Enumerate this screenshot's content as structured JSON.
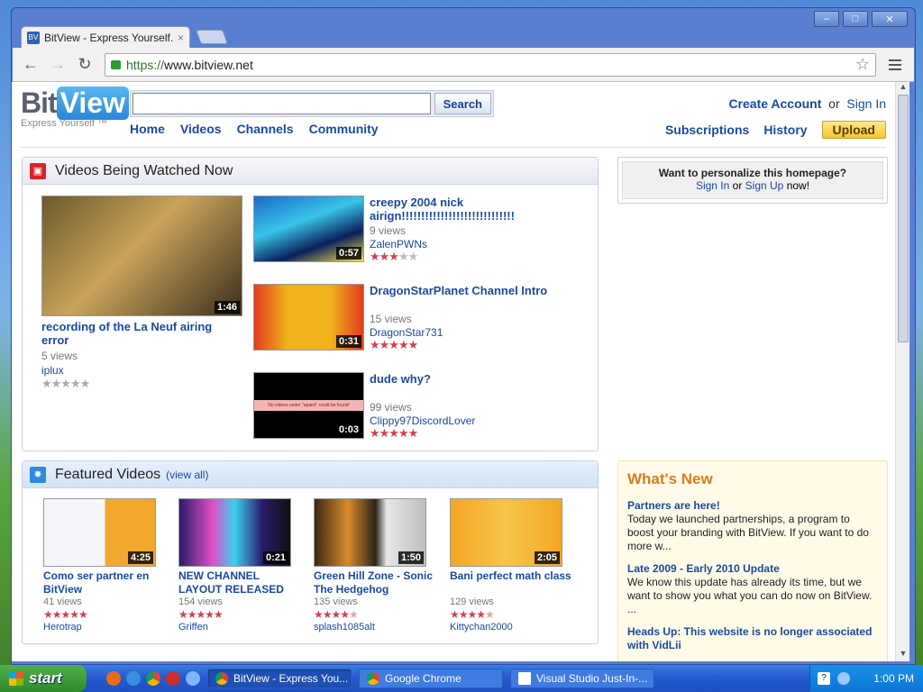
{
  "browser": {
    "tab_title": "BitView - Express Yourself.",
    "tab_close": "×",
    "url_scheme": "https://",
    "url_host": "www.bitview.net",
    "window_buttons": [
      "–",
      "□",
      "✕"
    ]
  },
  "header": {
    "logo_bit": "Bit",
    "logo_view": "View",
    "logo_tagline": "Express Yourself ™",
    "search_button": "Search",
    "nav": [
      "Home",
      "Videos",
      "Channels",
      "Community"
    ],
    "create_account": "Create Account",
    "or": "or",
    "sign_in": "Sign In",
    "subscriptions": "Subscriptions",
    "history": "History",
    "upload": "Upload"
  },
  "watched": {
    "heading": "Videos Being Watched Now",
    "main": {
      "title": "recording of the La Neuf airing error",
      "duration": "1:46",
      "views": "5 views",
      "user": "iplux",
      "rating": 0
    },
    "items": [
      {
        "title": "creepy 2004 nick airign!!!!!!!!!!!!!!!!!!!!!!!!!!!!!",
        "duration": "0:57",
        "views": "9 views",
        "user": "ZalenPWNs",
        "rating": 3
      },
      {
        "title": "DragonStarPlanet Channel Intro",
        "duration": "0:31",
        "views": "15 views",
        "user": "DragonStar731",
        "rating": 5
      },
      {
        "title": "dude why?",
        "duration": "0:03",
        "views": "99 views",
        "user": "Clippy97DiscordLover",
        "rating": 5,
        "thumb_text": "No videos under \"apaint\" could be found!"
      }
    ]
  },
  "featured": {
    "heading": "Featured Videos",
    "view_all": "(view all)",
    "items": [
      {
        "title": "Como ser partner en BitView",
        "duration": "4:25",
        "views": "41 views",
        "user": "Herotrap",
        "rating": 5
      },
      {
        "title": "NEW CHANNEL LAYOUT RELEASED",
        "duration": "0:21",
        "views": "154 views",
        "user": "Griffen",
        "rating": 5
      },
      {
        "title": "Green Hill Zone - Sonic The Hedgehog",
        "duration": "1:50",
        "views": "135 views",
        "user": "splash1085alt",
        "rating": 4.5
      },
      {
        "title": "Bani perfect math class",
        "duration": "2:05",
        "views": "129 views",
        "user": "Kittychan2000",
        "rating": 4.5
      }
    ]
  },
  "personalize": {
    "question": "Want to personalize this homepage?",
    "sign_in": "Sign In",
    "or": "or",
    "sign_up": "Sign Up",
    "now": "now!"
  },
  "whats_new": {
    "heading": "What's New",
    "items": [
      {
        "title": "Partners are here!",
        "body": "Today we launched partnerships, a program to boost your branding with BitView. If you want to do more w..."
      },
      {
        "title": "Late 2009 - Early 2010 Update",
        "body": "We know this update has already its time, but we want to show you what you can do now on BitView. ..."
      },
      {
        "title": "Heads Up: This website is no longer associated with VidLii",
        "body": ""
      }
    ]
  },
  "taskbar": {
    "start": "start",
    "tasks": [
      "BitView - Express You...",
      "Google Chrome",
      "Visual Studio Just-In-..."
    ],
    "clock": "1:00 PM"
  }
}
